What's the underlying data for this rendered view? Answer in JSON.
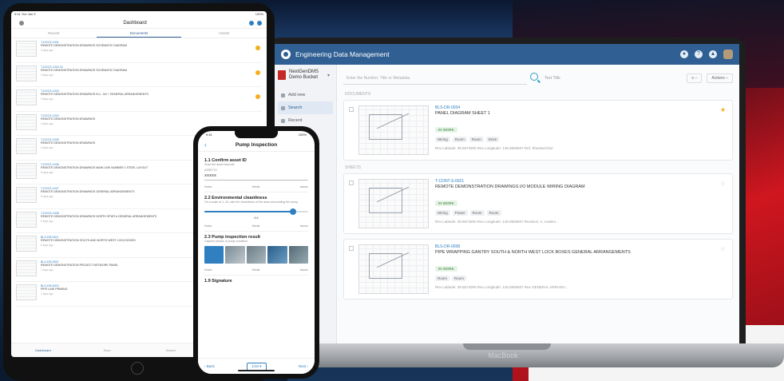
{
  "laptop": {
    "brand": "MacBook",
    "app": {
      "title": "Engineering Data Management",
      "bucket": {
        "name": "NextGenDMS Demo Bucket"
      },
      "sidebar": [
        {
          "label": "Add new"
        },
        {
          "label": "Search",
          "active": true
        },
        {
          "label": "Recent"
        }
      ],
      "search": {
        "placeholder": "Enter the Number, Title or Metadata",
        "options": "Text   Title"
      },
      "sort_label": "≡ –",
      "filter_label": "Actions –",
      "sections": [
        "DOCUMENTS",
        "SHEETS"
      ],
      "cards": [
        {
          "id": "BLS-DR-0004",
          "title": "PANEL DIAGRAM SHEET 1",
          "badge": "IN WORK",
          "tags": [
            "Wiring",
            "Room",
            "Room",
            "Drive"
          ],
          "meta": "Rev Latitude: 39.5674000 Rev Longitude: 146.9500607  Ref. Sheetarchive",
          "starred": true
        },
        {
          "id": "T-CONT-S-0021",
          "title": "REMOTE DEMONSTRATION DRAWINGS I/O MODULE WIRING DIAGRAM",
          "badge": "IN WORK",
          "tags": [
            "Wiring",
            "Power",
            "Room",
            "Room"
          ],
          "meta": "Rev Latitude: 39.5674000 Rev Longitude: 146.9500607  Revision: A, Anders...",
          "starred": false
        },
        {
          "id": "BLS-DR-0008",
          "title": "PIPE WRAPPING GANTRY SOUTH & NORTH WEST LOCK BOXES GENERAL ARRANGEMENTS",
          "badge": "IN WORK",
          "tags": [
            "Room",
            "Room"
          ],
          "meta": "Rev Latitude: 39.5674000 Rev Longitude: 146.9500607 Rev GENERAL ARRANG...",
          "starred": false
        }
      ]
    }
  },
  "tablet": {
    "status_left": "9:41  Tue Jan 9",
    "status_right": "100%",
    "header_title": "Dashboard",
    "tabs": [
      {
        "label": "Recent",
        "active": false
      },
      {
        "label": "Documents",
        "active": true
      },
      {
        "label": "Assets",
        "active": false
      }
    ],
    "rows": [
      {
        "id": "T-DOCS-1001",
        "title": "REMOTE DEMONSTRATION DRAWINGS SCHEMATIC DIAGRAM",
        "date": "3 days ago",
        "starred": true
      },
      {
        "id": "T-DOCS-1002-01",
        "title": "REMOTE DEMONSTRATION DRAWINGS SCHEMATIC DIAGRAM",
        "date": "3 days ago",
        "starred": true
      },
      {
        "id": "T-DOCS-1003",
        "title": "REMOTE DEMONSTRATION DRAWINGS ELL. 3/4 + GENERAL ARRANGEMENTS",
        "date": "3 days ago",
        "starred": true
      },
      {
        "id": "T-DOCS-1004",
        "title": "REMOTE DEMONSTRATION DRAWINGS",
        "date": "4 days ago",
        "starred": false
      },
      {
        "id": "T-DOCS-1005",
        "title": "REMOTE DEMONSTRATION DRAWINGS",
        "date": "4 days ago",
        "starred": false
      },
      {
        "id": "T-DOCS-1006",
        "title": "REMOTE DEMONSTRATION DRAWINGS MAIN LINE NUMBER 1 STEEL LAYOUT",
        "date": "5 days ago",
        "starred": false
      },
      {
        "id": "T-DOCS-1007",
        "title": "REMOTE DEMONSTRATION DRAWINGS GENERAL ARRANGEMENTS",
        "date": "5 days ago",
        "starred": false
      },
      {
        "id": "T-DOCS-1008",
        "title": "REMOTE DEMONSTRATION DRAWINGS NORTH SPUR A GENERAL ARRANGEMENTS",
        "date": "6 days ago",
        "starred": false
      },
      {
        "id": "BLS-DR-0001",
        "title": "REMOTE DEMONSTRATION SOUTH AND NORTH WEST LOCK BOXES",
        "date": "6 days ago",
        "starred": false
      },
      {
        "id": "BLS-DR-0002",
        "title": "REMOTE DEMONSTRATION PROJECT NETWORK PANEL",
        "date": "7 days ago",
        "starred": false
      },
      {
        "id": "BLS-DR-0003",
        "title": "PIPE LINE PRIMING",
        "date": "7 days ago",
        "starred": false
      }
    ],
    "bottom_nav": [
      {
        "label": "Dashboard",
        "active": true
      },
      {
        "label": "Scan",
        "active": false
      },
      {
        "label": "Search",
        "active": false
      },
      {
        "label": "Settings",
        "active": false
      }
    ]
  },
  "phone": {
    "status_left": "9:41",
    "status_right": "100%",
    "header_title": "Pump Inspection",
    "back_glyph": "‹",
    "sections": {
      "confirm": {
        "title": "1.1 Confirm asset ID",
        "subtitle": "Scan the asset barcode",
        "field_label": "ASSET ID",
        "field_value": "XXXXX"
      },
      "cleanliness": {
        "title": "2.2 Environmental cleanliness",
        "subtitle": "On a scale of 1–10, rate the cleanliness of the area surrounding the pump",
        "slider_value": 8.5,
        "slider_max": 10,
        "slider_label": "8.5"
      },
      "result": {
        "title": "2.3 Pump inspection result",
        "subtitle": "Capture photos of pump condition"
      },
      "signature": {
        "title": "1.9 Signature"
      }
    },
    "actions": [
      "Notes",
      "Media",
      "Issues"
    ],
    "bottom": {
      "back": "‹ Back",
      "page": "1/10 ▾",
      "next": "Next ›"
    }
  }
}
